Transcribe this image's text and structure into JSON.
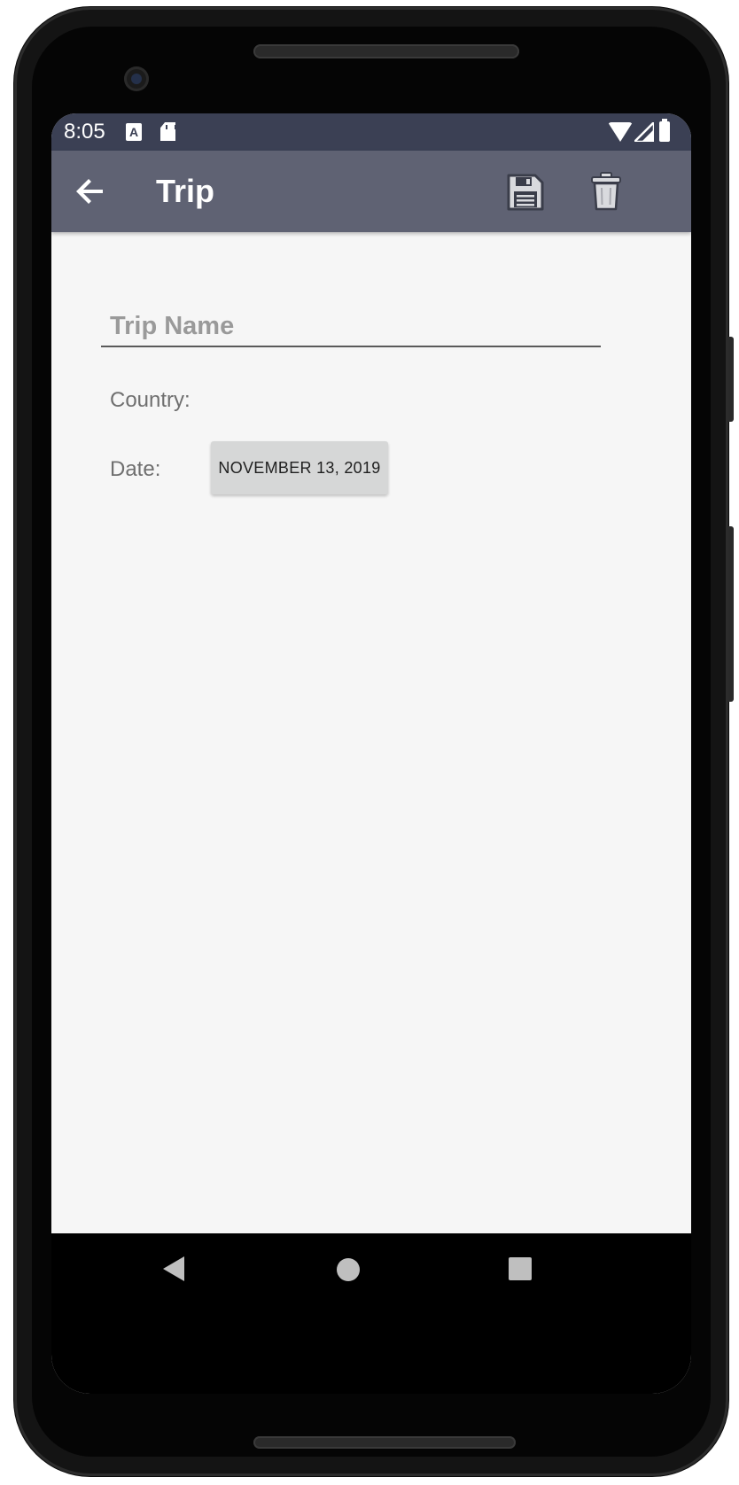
{
  "status_bar": {
    "time": "8:05",
    "icons": [
      "a-notification-icon",
      "sd-card-icon",
      "wifi-icon",
      "signal-icon",
      "battery-icon"
    ]
  },
  "app_bar": {
    "title": "Trip",
    "actions": [
      "back-arrow-icon",
      "save-icon",
      "delete-icon"
    ]
  },
  "form": {
    "trip_name_placeholder": "Trip Name",
    "trip_name_value": "",
    "country_label": "Country:",
    "date_label": "Date:",
    "date_button_label": "NOVEMBER 13, 2019"
  },
  "nav_bar": {
    "buttons": [
      "nav-back-icon",
      "home-icon",
      "recents-icon"
    ]
  },
  "colors": {
    "status_bar": "#3b4054",
    "app_bar": "#5f6273",
    "background": "#f6f6f6",
    "date_button": "#d6d7d7"
  }
}
